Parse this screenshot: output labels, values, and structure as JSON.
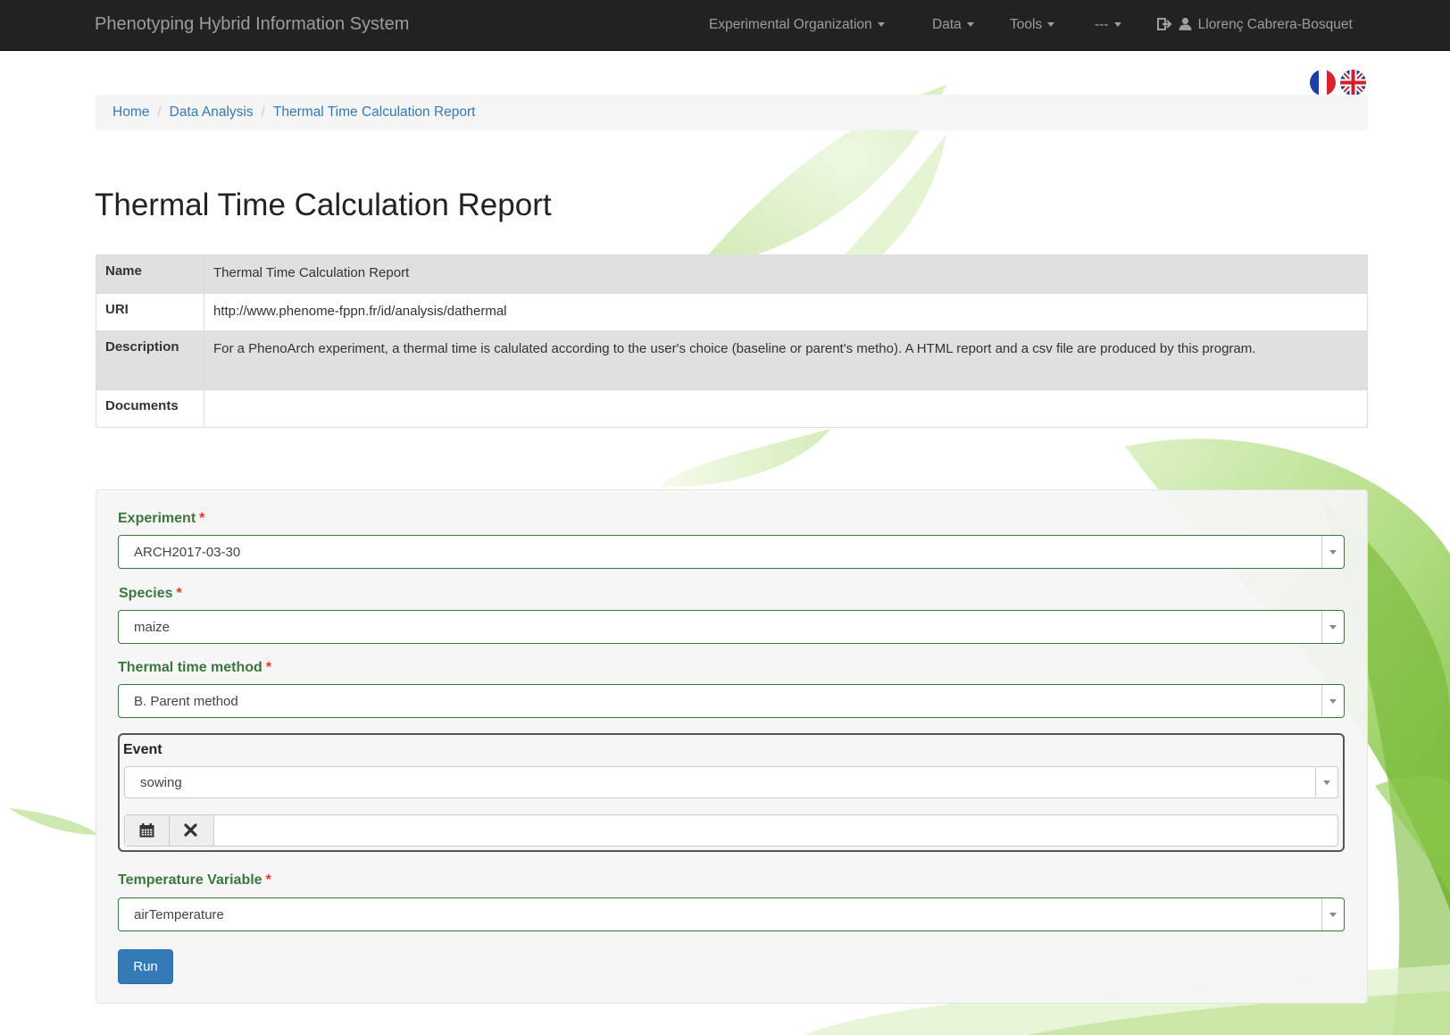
{
  "navbar": {
    "brand": "Phenotyping Hybrid Information System",
    "menus": [
      "Experimental Organization",
      "Data",
      "Tools",
      "---"
    ],
    "user": "Llorenç Cabrera-Bosquet"
  },
  "languages": [
    "fr",
    "en"
  ],
  "breadcrumb": [
    "Home",
    "Data Analysis",
    "Thermal Time Calculation Report"
  ],
  "page_title": "Thermal Time Calculation Report",
  "details": [
    {
      "label": "Name",
      "value": "Thermal Time Calculation Report"
    },
    {
      "label": "URI",
      "value": "http://www.phenome-fppn.fr/id/analysis/dathermal"
    },
    {
      "label": "Description",
      "value": "For a PhenoArch experiment, a thermal time is calulated according to the user's choice (baseline or parent's metho). A HTML report and a csv file are produced by this program."
    },
    {
      "label": "Documents",
      "value": ""
    }
  ],
  "form": {
    "required_mark": "*",
    "experiment": {
      "label": "Experiment",
      "value": "ARCH2017-03-30"
    },
    "species": {
      "label": "Species",
      "value": "maize"
    },
    "method": {
      "label": "Thermal time method",
      "value": "B. Parent method"
    },
    "event": {
      "label": "Event",
      "value": "sowing",
      "date": ""
    },
    "temperature": {
      "label": "Temperature Variable",
      "value": "airTemperature"
    },
    "run_label": "Run"
  },
  "colors": {
    "navbar": "#222222",
    "link": "#337ab7",
    "success": "#3c763d",
    "primary": "#337ab7"
  }
}
